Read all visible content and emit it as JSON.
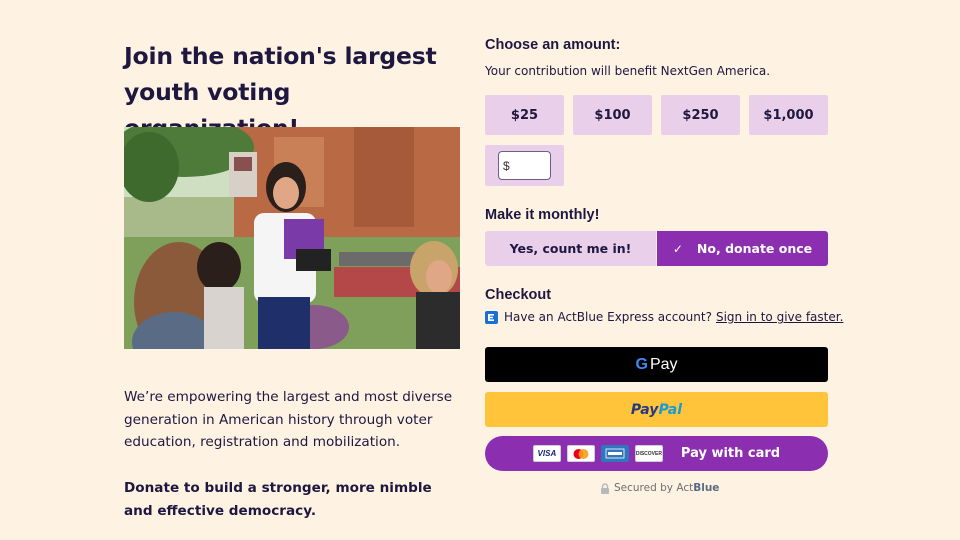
{
  "left": {
    "headline": "Join the nation's largest youth voting organization!",
    "description": "We’re empowering the largest and most diverse generation in American history through voter education, registration and mobilization.",
    "cta": "Donate to build a stronger, more nimble and effective democracy."
  },
  "amount": {
    "title": "Choose an amount:",
    "subtitle": "Your contribution will benefit NextGen America.",
    "options": [
      "$25",
      "$100",
      "$250",
      "$1,000"
    ],
    "custom_prefix": "$",
    "custom_value": ""
  },
  "monthly": {
    "title": "Make it monthly!",
    "yes_label": "Yes, count me in!",
    "no_label": "No, donate once",
    "selected": "no"
  },
  "checkout": {
    "title": "Checkout",
    "express_text": "Have an ActBlue Express account?",
    "express_link": "Sign in to give faster.",
    "gpay_g": "G",
    "gpay_label": "Pay",
    "paypal_part1": "Pay",
    "paypal_part2": "Pal",
    "card_logos": [
      "VISA",
      "MC",
      "AMEX",
      "DISCOVER"
    ],
    "card_label": "Pay with card",
    "secured_prefix": "Secured by Act",
    "secured_brand": "Blue"
  },
  "colors": {
    "background": "#fef3e2",
    "text": "#1e1740",
    "option_bg": "#e9cfe9",
    "accent": "#8b2fb0",
    "paypal": "#ffc439"
  }
}
